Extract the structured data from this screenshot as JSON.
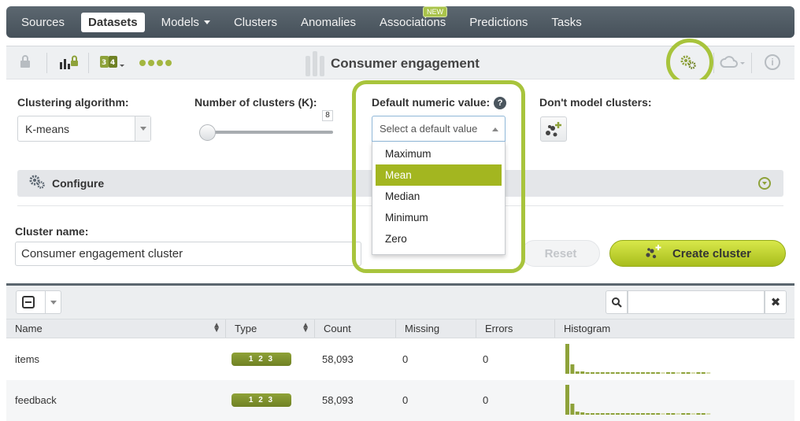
{
  "nav": {
    "items": [
      {
        "label": "Sources",
        "active": false
      },
      {
        "label": "Datasets",
        "active": true
      },
      {
        "label": "Models",
        "active": false
      },
      {
        "label": "Clusters",
        "active": false
      },
      {
        "label": "Anomalies",
        "active": false
      },
      {
        "label": "Associations",
        "active": false
      },
      {
        "label": "Predictions",
        "active": false
      },
      {
        "label": "Tasks",
        "active": false
      }
    ],
    "new_badge": "NEW"
  },
  "toolbar": {
    "title": "Consumer engagement",
    "icons": [
      "lock-icon",
      "bar-chart-lock-icon",
      "numeric-dropdown-icon",
      "dots-icon",
      "gear-icon",
      "cloud-icon",
      "info-icon"
    ],
    "info_glyph": "i"
  },
  "form": {
    "algorithm_label": "Clustering algorithm:",
    "algorithm_value": "K-means",
    "k_label": "Number of clusters (K):",
    "k_value": "8",
    "default_label": "Default numeric value:",
    "default_help": "?",
    "default_placeholder": "Select a default value",
    "default_options": [
      "Maximum",
      "Mean",
      "Median",
      "Minimum",
      "Zero"
    ],
    "default_selected": "Mean",
    "dont_model_label": "Don't model clusters:",
    "configure_label": "Configure",
    "cluster_name_label": "Cluster name:",
    "cluster_name_value": "Consumer engagement cluster",
    "reset_label": "Reset",
    "create_label": "Create cluster"
  },
  "table": {
    "columns": [
      "Name",
      "Type",
      "Count",
      "Missing",
      "Errors",
      "Histogram"
    ],
    "rows": [
      {
        "name": "items",
        "type": "1 2 3",
        "count": "58,093",
        "missing": "0",
        "errors": "0",
        "histogram": [
          38,
          12,
          3,
          3,
          2,
          2,
          2,
          2,
          2,
          2,
          2,
          2,
          2,
          2,
          2,
          2,
          2,
          2,
          2,
          2,
          2,
          2,
          2,
          2,
          2,
          2,
          2,
          2,
          2
        ]
      },
      {
        "name": "feedback",
        "type": "1 2 3",
        "count": "58,093",
        "missing": "0",
        "errors": "0",
        "histogram": [
          38,
          14,
          4,
          3,
          2,
          2,
          2,
          2,
          2,
          2,
          2,
          2,
          2,
          2,
          2,
          2,
          2,
          2,
          2,
          2,
          2,
          2,
          2,
          2,
          2,
          2,
          2,
          2,
          2
        ]
      }
    ]
  },
  "colors": {
    "accent": "#a8c43c",
    "nav_bg": "#4f5a63",
    "histogram": "#8ea23a",
    "histogram_light": "#d5dba8"
  }
}
